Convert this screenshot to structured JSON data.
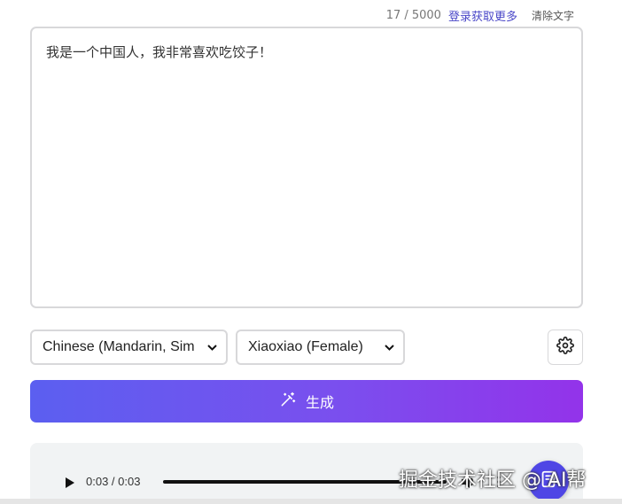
{
  "header": {
    "char_count": "17 / 5000",
    "login_link": "登录获取更多",
    "clear_link": "清除文字"
  },
  "editor": {
    "text": "我是一个中国人，我非常喜欢吃饺子！"
  },
  "controls": {
    "language_selected": "Chinese (Mandarin, Sim",
    "voice_selected": "Xiaoxiao (Female)",
    "settings_icon": "gear-icon",
    "generate_label": "生成",
    "generate_icon": "magic-wand-icon"
  },
  "player": {
    "time": "0:03 / 0:03",
    "progress": 1.0
  },
  "overlay": {
    "watermark": "掘金技术社区 @ AI帮"
  },
  "colors": {
    "accent": "#4a47c8",
    "gradient_start": "#5b5ff0",
    "gradient_end": "#9333ea",
    "float_button": "#4f46e5"
  }
}
